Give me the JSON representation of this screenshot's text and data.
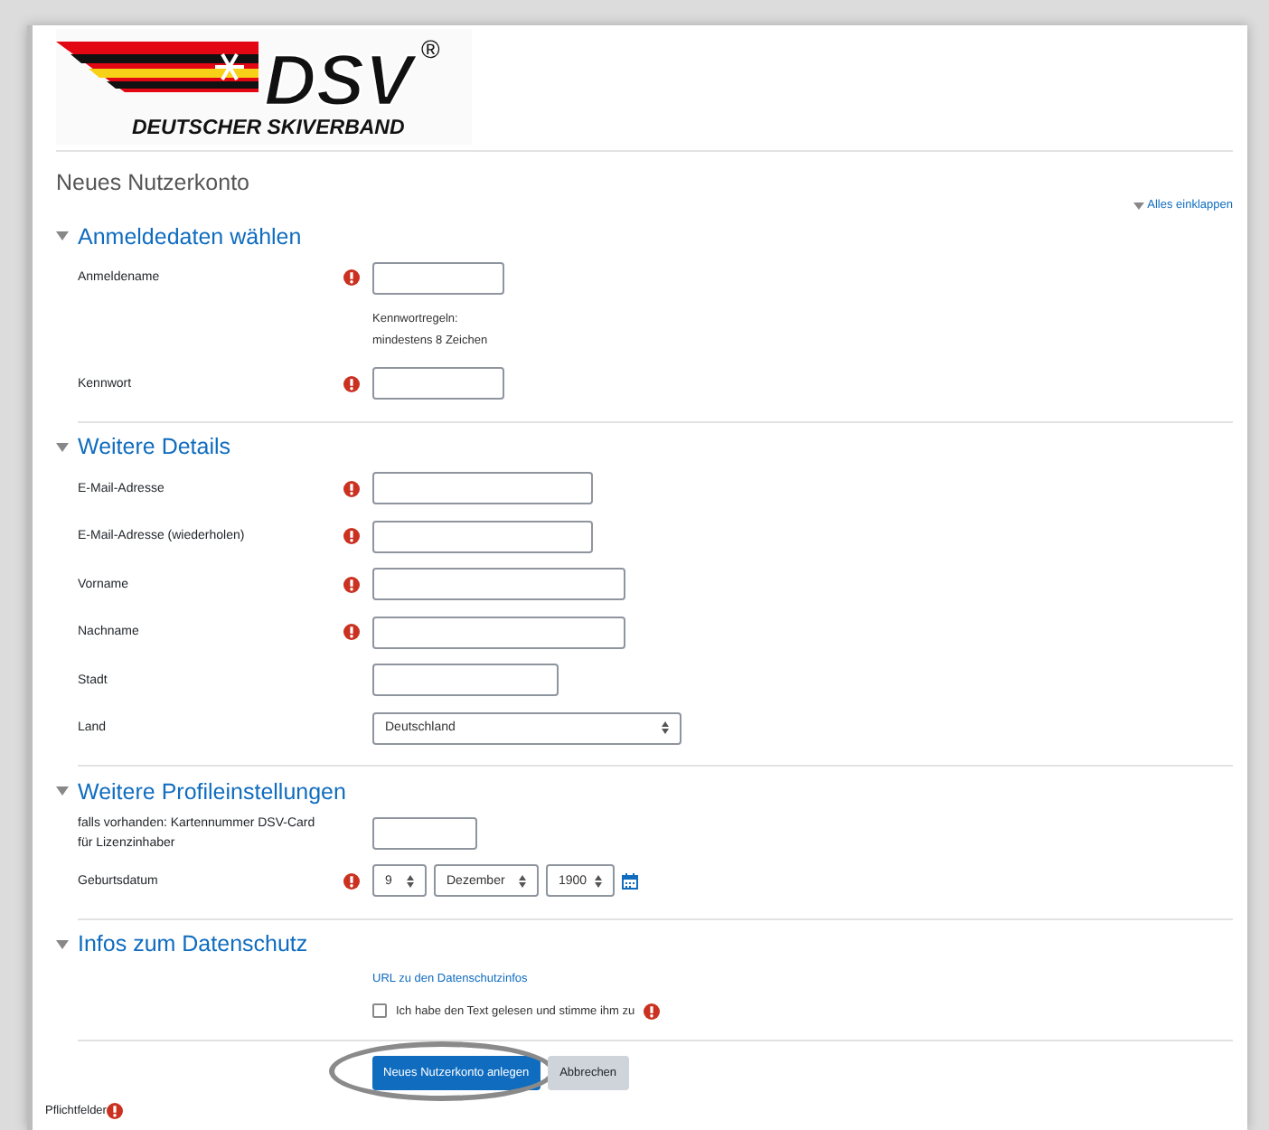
{
  "logo": {
    "letters": "DSV",
    "mark": "®",
    "tagline": "DEUTSCHER SKIVERBAND"
  },
  "page_title": "Neues Nutzerkonto",
  "collapse_all": {
    "label": "Alles einklappen",
    "expanded": true
  },
  "sections": [
    {
      "title": "Anmeldedaten wählen",
      "expanded": true,
      "rows": [
        {
          "kind": "text",
          "label": "Anmeldename",
          "required": true
        },
        {
          "kind": "note",
          "lines": [
            "Kennwortregeln:",
            "mindestens 8 Zeichen"
          ]
        },
        {
          "kind": "text",
          "label": "Kennwort",
          "required": true
        }
      ]
    },
    {
      "title": "Weitere Details",
      "expanded": true,
      "rows": [
        {
          "kind": "text",
          "label": "E-Mail-Adresse",
          "required": true
        },
        {
          "kind": "text",
          "label": "E-Mail-Adresse (wiederholen)",
          "required": true
        },
        {
          "kind": "text",
          "label": "Vorname",
          "required": true
        },
        {
          "kind": "text",
          "label": "Nachname",
          "required": true
        },
        {
          "kind": "text",
          "label": "Stadt",
          "required": false
        },
        {
          "kind": "select",
          "label": "Land",
          "required": false,
          "value": "Deutschland"
        }
      ]
    },
    {
      "title": "Weitere Profileinstellungen",
      "expanded": true,
      "rows": [
        {
          "kind": "text",
          "label": "falls vorhanden: Kartennummer DSV-Card für Lizenzinhaber",
          "required": false
        },
        {
          "kind": "date",
          "label": "Geburtsdatum",
          "required": true,
          "day": "9",
          "month": "Dezember",
          "year": "1900"
        }
      ]
    },
    {
      "title": "Infos zum Datenschutz",
      "expanded": true,
      "rows": [
        {
          "kind": "link",
          "text": "URL zu den Datenschutzinfos"
        },
        {
          "kind": "checkbox",
          "label": "Ich habe den Text gelesen und stimme ihm zu",
          "checked": false,
          "required": true
        }
      ]
    }
  ],
  "buttons": [
    {
      "label": "Neues Nutzerkonto anlegen",
      "kind": "primary",
      "highlighted": true
    },
    {
      "label": "Abbrechen",
      "kind": "secondary",
      "highlighted": false
    }
  ],
  "footer": {
    "label": "Pflichtfelder"
  }
}
